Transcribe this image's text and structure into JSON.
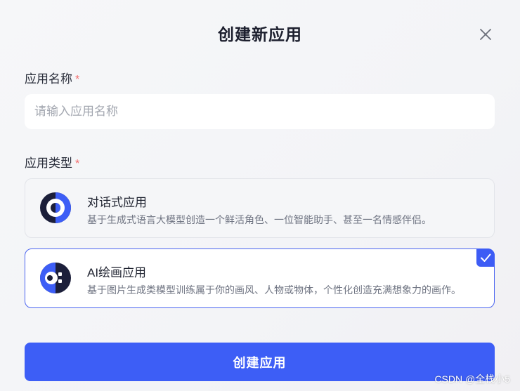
{
  "dialog": {
    "title": "创建新应用",
    "close_icon": "close-icon"
  },
  "form": {
    "name_label": "应用名称",
    "name_required": "*",
    "name_value": "",
    "name_placeholder": "请输入应用名称",
    "type_label": "应用类型",
    "type_required": "*",
    "types": [
      {
        "title": "对话式应用",
        "description": "基于生成式语言大模型创造一个鲜活角色、一位智能助手、甚至一名情感伴侣。",
        "icon": "chat-app-icon",
        "selected": false
      },
      {
        "title": "AI绘画应用",
        "description": "基于图片生成类模型训练属于你的画风、人物或物体，个性化创造充满想象力的画作。",
        "icon": "ai-painting-icon",
        "selected": true
      }
    ],
    "submit_label": "创建应用"
  },
  "colors": {
    "accent": "#3d5ef6",
    "required": "#f36b6b",
    "selected_border": "#4a64f0"
  },
  "watermark": "CSDN @全栈小5"
}
